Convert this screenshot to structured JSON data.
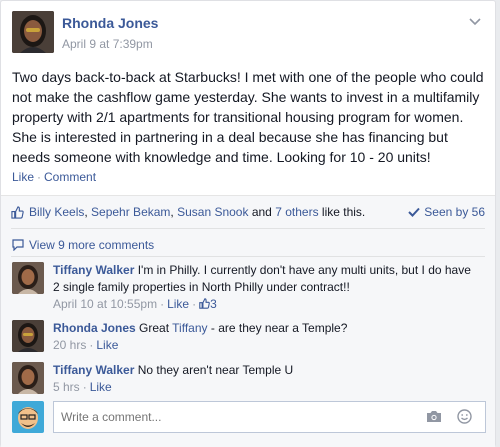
{
  "post": {
    "author": "Rhonda Jones",
    "date": "April 9 at 7:39pm",
    "text": "Two days back-to-back at Starbucks! I met with one of the people who could not make the cashflow game yesterday. She wants to invest in a multifamily property with 2/1 apartments for transitional housing program for women. She is interested in partnering in a deal because she has financing but needs someone with knowledge and time. Looking for 10 - 20 units!",
    "actions": {
      "like": "Like",
      "comment": "Comment"
    }
  },
  "feedback": {
    "likers": [
      "Billy Keels",
      "Sepehr Bekam",
      "Susan Snook"
    ],
    "and_text": "and",
    "others": "7 others",
    "like_this": "like this.",
    "seen_by": "Seen by 56",
    "view_more": "View 9 more comments"
  },
  "comments": [
    {
      "name": "Tiffany Walker",
      "text": "I'm in Philly. I currently don't have any multi units, but I do have 2 single family properties in North Philly under contract!!",
      "time": "April 10 at 10:55pm",
      "like": "Like",
      "like_count": "3"
    },
    {
      "name": "Rhonda Jones",
      "text_before": "Great",
      "mention": "Tiffany",
      "text_after": "- are they near a Temple?",
      "time": "20 hrs",
      "like": "Like"
    },
    {
      "name": "Tiffany Walker",
      "text": "No they aren't near Temple U",
      "time": "5 hrs",
      "like": "Like"
    }
  ],
  "composer": {
    "placeholder": "Write a comment..."
  },
  "colors": {
    "link": "#3b5998",
    "meta": "#9197a3",
    "text": "#141823",
    "feedback_bg": "#f6f7f9"
  },
  "icons": [
    "chevron-down-icon",
    "thumbs-up-icon",
    "checkmark-icon",
    "comment-bubble-icon",
    "camera-icon",
    "smiley-icon"
  ]
}
